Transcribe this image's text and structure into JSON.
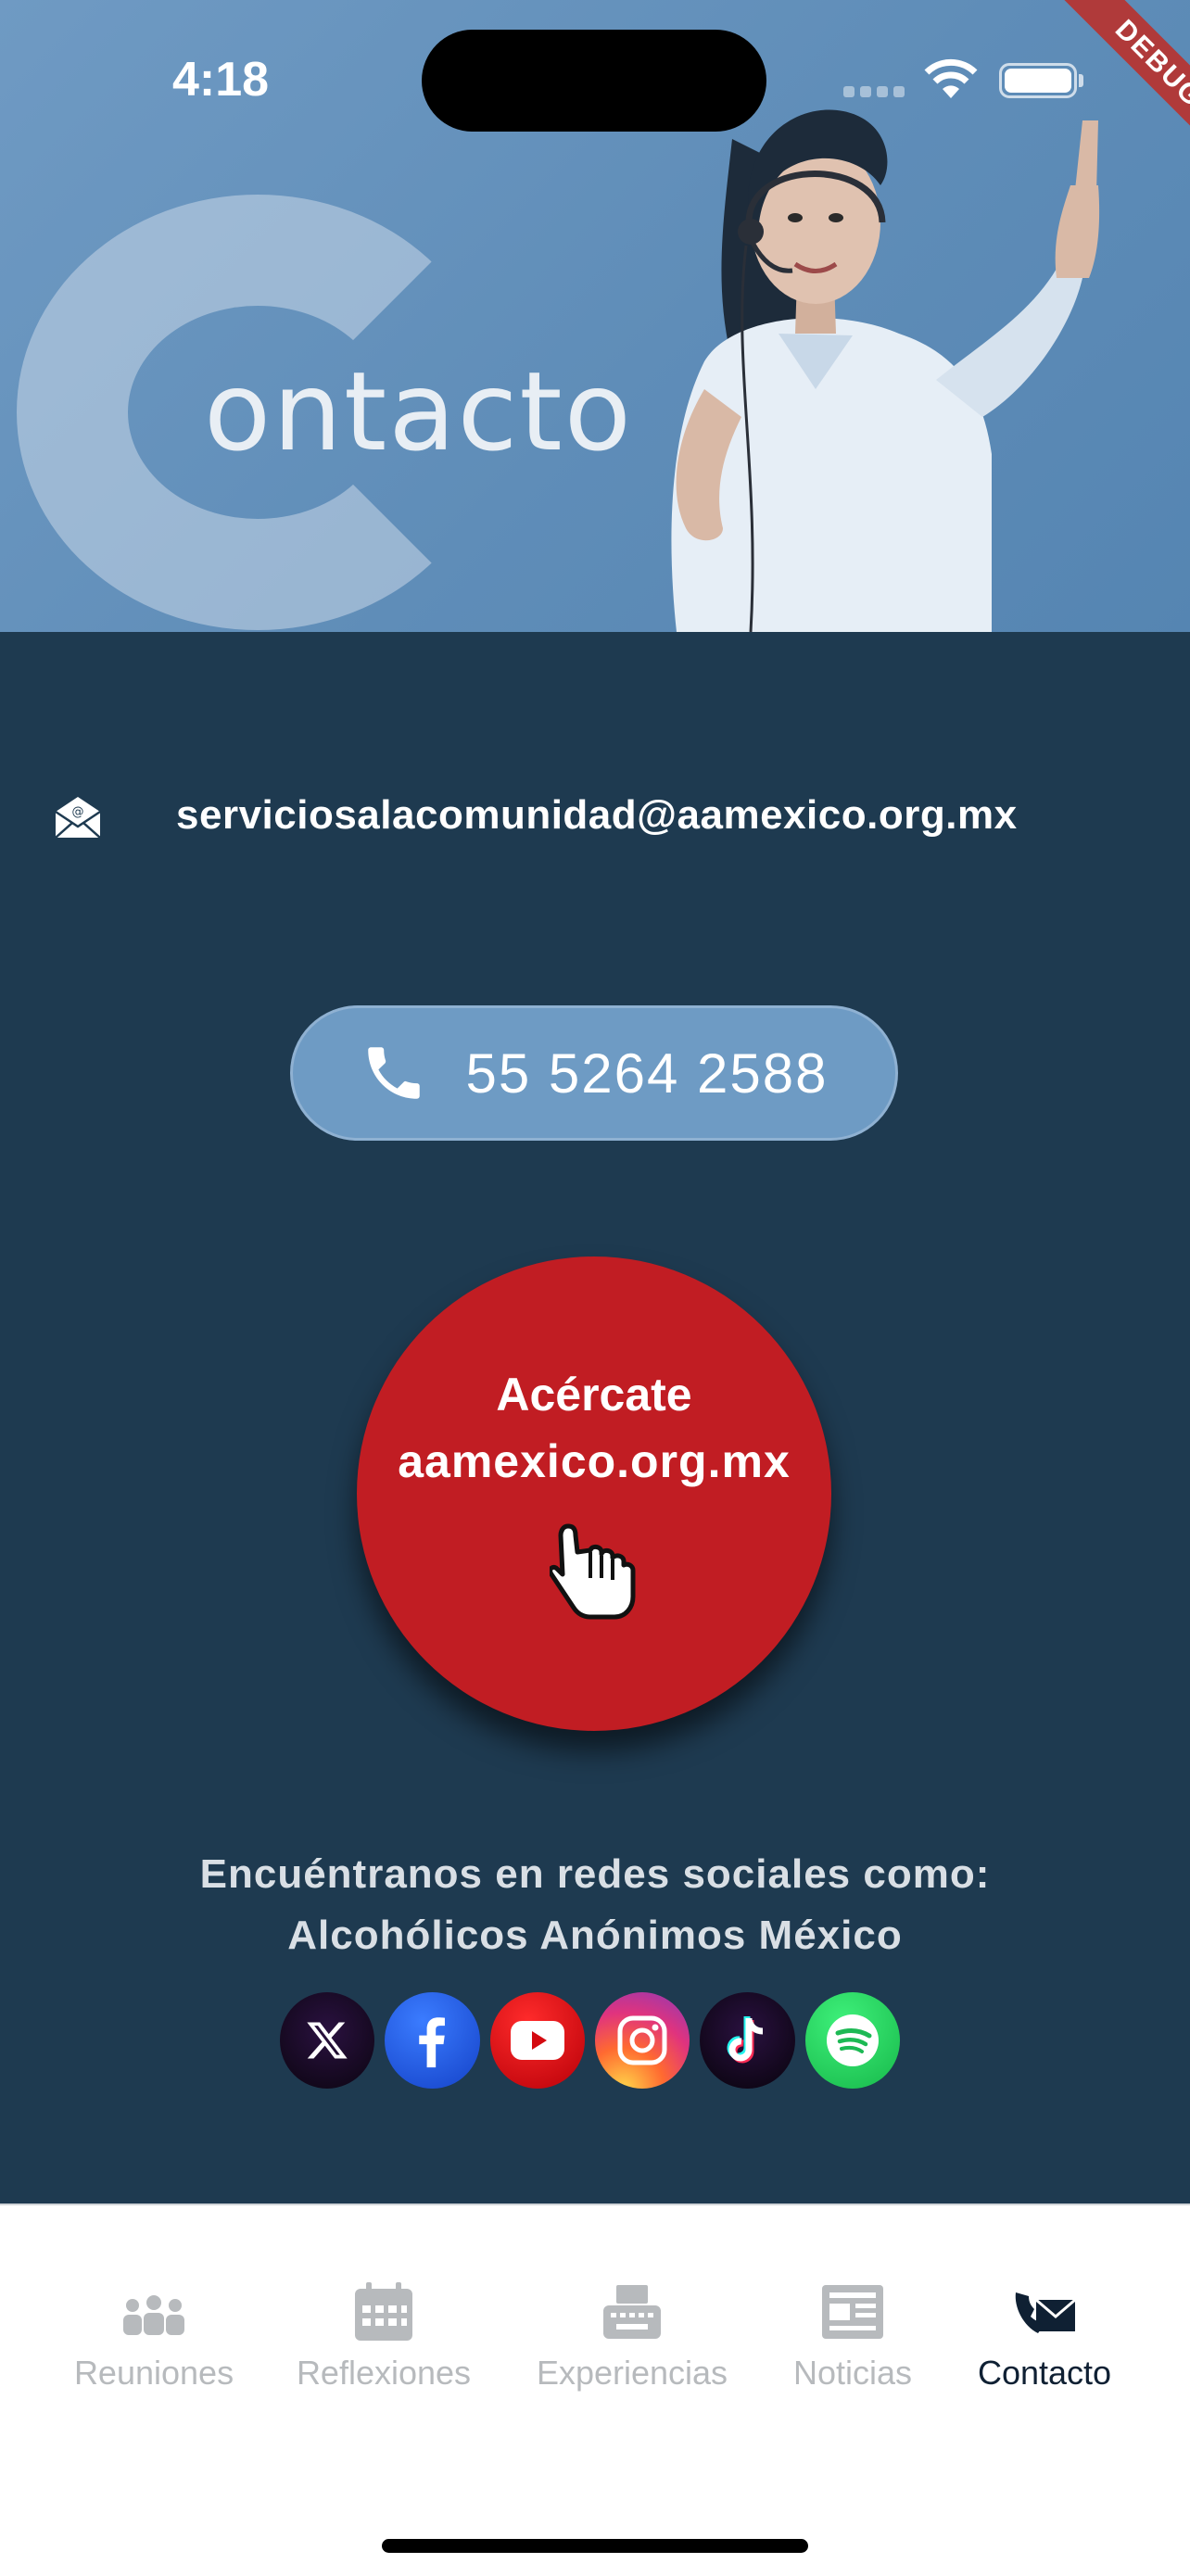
{
  "status_bar": {
    "time": "4:18",
    "debug_label": "DEBUG"
  },
  "header": {
    "banner_word": "ontacto"
  },
  "email": {
    "icon": "envelope-icon",
    "address": "serviciosalacomunidad@aamexico.org.mx"
  },
  "phone": {
    "icon": "phone-icon",
    "number": "55 5264 2588"
  },
  "cta": {
    "line1": "Acércate",
    "line2": "aamexico.org.mx",
    "icon": "pointing-hand-icon"
  },
  "social": {
    "line1": "Encuéntranos en redes sociales como:",
    "line2": "Alcohólicos Anónimos México",
    "networks": [
      {
        "name": "X",
        "icon": "x-icon"
      },
      {
        "name": "Facebook",
        "icon": "facebook-icon"
      },
      {
        "name": "YouTube",
        "icon": "youtube-icon"
      },
      {
        "name": "Instagram",
        "icon": "instagram-icon"
      },
      {
        "name": "TikTok",
        "icon": "tiktok-icon"
      },
      {
        "name": "Spotify",
        "icon": "spotify-icon"
      }
    ]
  },
  "nav": {
    "items": [
      {
        "label": "Reuniones",
        "icon": "people-group-icon",
        "active": false
      },
      {
        "label": "Reflexiones",
        "icon": "calendar-icon",
        "active": false
      },
      {
        "label": "Experiencias",
        "icon": "typewriter-icon",
        "active": false
      },
      {
        "label": "Noticias",
        "icon": "newspaper-icon",
        "active": false
      },
      {
        "label": "Contacto",
        "icon": "envelope-phone-icon",
        "active": true
      }
    ]
  },
  "colors": {
    "background": "#1e3a50",
    "phone_button": "#6e9bc4",
    "cta_red": "#c11d23",
    "nav_active": "#0f2033",
    "nav_inactive": "#b7babd"
  }
}
